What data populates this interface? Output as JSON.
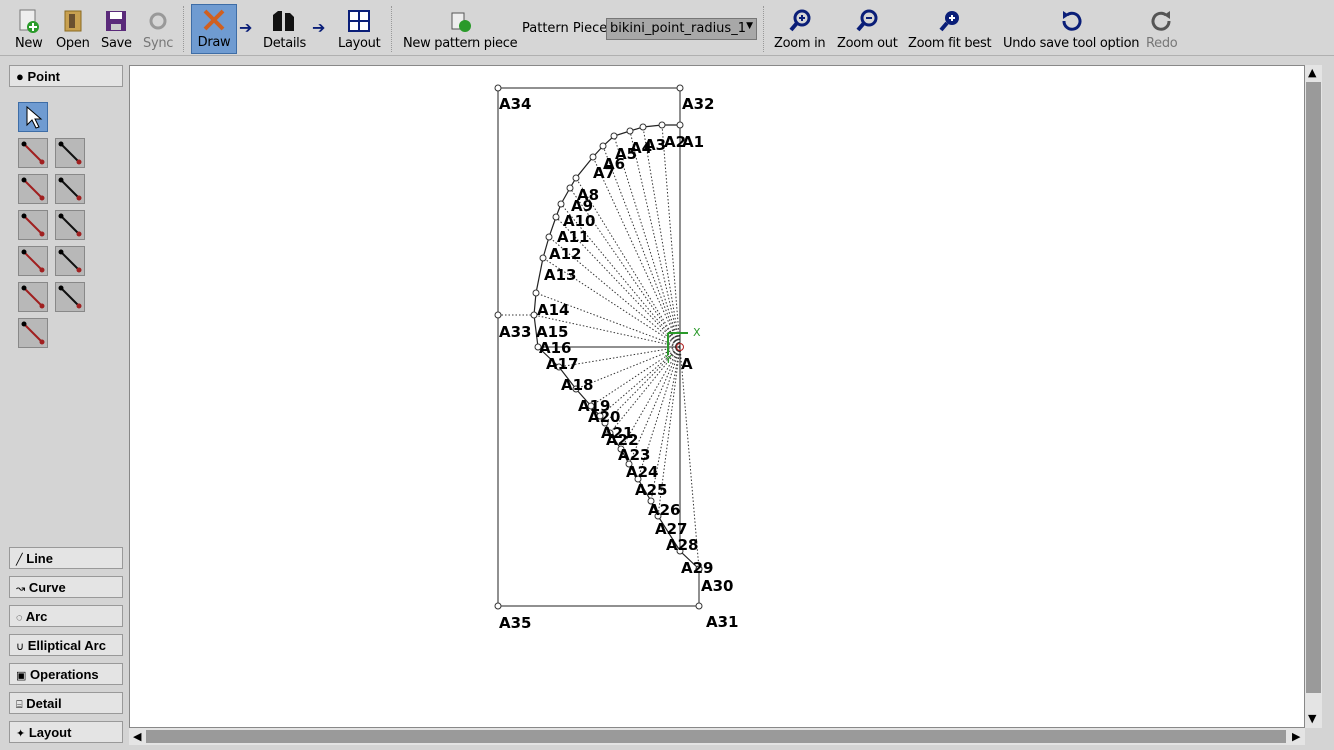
{
  "toolbar": {
    "new": "New",
    "open": "Open",
    "save": "Save",
    "sync": "Sync",
    "draw": "Draw",
    "details": "Details",
    "layout": "Layout",
    "new_piece": "New pattern piece",
    "pattern_piece_label": "Pattern Piece:",
    "pattern_piece_value": "bikini_point_radius_1",
    "zoom_in": "Zoom in",
    "zoom_out": "Zoom out",
    "zoom_fit": "Zoom fit best",
    "undo": "Undo save tool option",
    "redo": "Redo"
  },
  "left": {
    "point": "Point",
    "groups": [
      "Line",
      "Curve",
      "Arc",
      "Elliptical Arc",
      "Operations",
      "Detail",
      "Layout"
    ],
    "group_icons": [
      "line-icon",
      "curve-icon",
      "arc-icon",
      "elliptical-arc-icon",
      "operations-icon",
      "detail-icon",
      "layout-icon"
    ]
  },
  "drawing": {
    "center_label": "A",
    "arc_labels": [
      "A1",
      "A2",
      "A3",
      "A4",
      "A5",
      "A6",
      "A7",
      "A8",
      "A9",
      "A10",
      "A11",
      "A12",
      "A13",
      "A14",
      "A15",
      "A16"
    ],
    "lower_labels": [
      "A17",
      "A18",
      "A19",
      "A20",
      "A21",
      "A22",
      "A23",
      "A24",
      "A25",
      "A26",
      "A27",
      "A28",
      "A29"
    ],
    "frame_labels": [
      "A30",
      "A31",
      "A32",
      "A33",
      "A34",
      "A35"
    ],
    "axis_x": "X",
    "axis_y": "Y",
    "accent": "#2a9a2a"
  }
}
